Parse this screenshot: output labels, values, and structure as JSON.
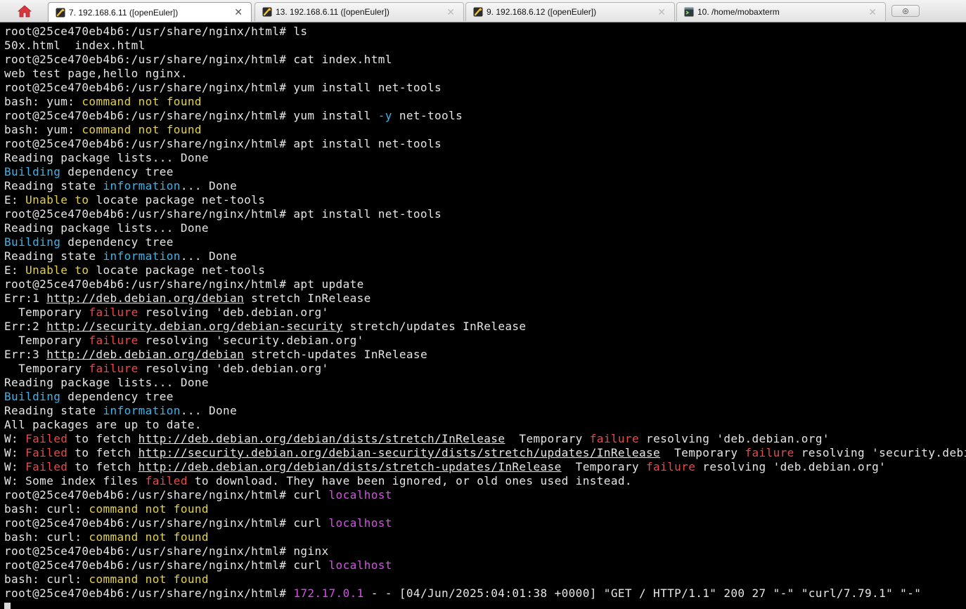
{
  "tabs": [
    {
      "label": "7. 192.168.6.11 ([openEuler])",
      "icon": "ssh-session-icon",
      "active": true
    },
    {
      "label": "13. 192.168.6.11 ([openEuler])",
      "icon": "ssh-session-icon",
      "active": false
    },
    {
      "label": "9. 192.168.6.12 ([openEuler])",
      "icon": "ssh-session-icon",
      "active": false
    },
    {
      "label": "10. /home/mobaxterm",
      "icon": "local-terminal-icon",
      "active": false
    }
  ],
  "tab_close_glyph": "✕",
  "colors": {
    "prompt": "#e6e6e6",
    "warning": "#e4d24a",
    "info": "#3fb3e6",
    "error": "#e84a4a",
    "highlight": "#d84fe8",
    "background": "#000000"
  },
  "lines": [
    {
      "segs": [
        {
          "t": "root@25ce470eb4b6:/usr/share/nginx/html# ls"
        }
      ]
    },
    {
      "segs": [
        {
          "t": "50x.html  index.html"
        }
      ]
    },
    {
      "segs": [
        {
          "t": "root@25ce470eb4b6:/usr/share/nginx/html# cat index.html"
        }
      ]
    },
    {
      "segs": [
        {
          "t": "web test page,hello nginx."
        }
      ]
    },
    {
      "segs": [
        {
          "t": "root@25ce470eb4b6:/usr/share/nginx/html# yum install net-tools"
        }
      ]
    },
    {
      "segs": [
        {
          "t": "bash: yum: "
        },
        {
          "t": "command not found",
          "c": "yellow"
        }
      ]
    },
    {
      "segs": [
        {
          "t": "root@25ce470eb4b6:/usr/share/nginx/html# yum install "
        },
        {
          "t": "-y",
          "c": "blue"
        },
        {
          "t": " net-tools"
        }
      ]
    },
    {
      "segs": [
        {
          "t": "bash: yum: "
        },
        {
          "t": "command not found",
          "c": "yellow"
        }
      ]
    },
    {
      "segs": [
        {
          "t": "root@25ce470eb4b6:/usr/share/nginx/html# apt install net-tools"
        }
      ]
    },
    {
      "segs": [
        {
          "t": "Reading package lists... Done"
        }
      ]
    },
    {
      "segs": [
        {
          "t": "Building",
          "c": "blue"
        },
        {
          "t": " dependency tree"
        }
      ]
    },
    {
      "segs": [
        {
          "t": "Reading state "
        },
        {
          "t": "information",
          "c": "blue"
        },
        {
          "t": "... Done"
        }
      ]
    },
    {
      "segs": [
        {
          "t": "E: "
        },
        {
          "t": "Unable to",
          "c": "yellow"
        },
        {
          "t": " locate package net-tools"
        }
      ]
    },
    {
      "segs": [
        {
          "t": "root@25ce470eb4b6:/usr/share/nginx/html# apt install net-tools"
        }
      ]
    },
    {
      "segs": [
        {
          "t": "Reading package lists... Done"
        }
      ]
    },
    {
      "segs": [
        {
          "t": "Building",
          "c": "blue"
        },
        {
          "t": " dependency tree"
        }
      ]
    },
    {
      "segs": [
        {
          "t": "Reading state "
        },
        {
          "t": "information",
          "c": "blue"
        },
        {
          "t": "... Done"
        }
      ]
    },
    {
      "segs": [
        {
          "t": "E: "
        },
        {
          "t": "Unable to",
          "c": "yellow"
        },
        {
          "t": " locate package net-tools"
        }
      ]
    },
    {
      "segs": [
        {
          "t": "root@25ce470eb4b6:/usr/share/nginx/html# apt update"
        }
      ]
    },
    {
      "segs": [
        {
          "t": "Err:1 "
        },
        {
          "t": "http://deb.debian.org/debian",
          "c": "url"
        },
        {
          "t": " stretch InRelease"
        }
      ]
    },
    {
      "segs": [
        {
          "t": "  Temporary "
        },
        {
          "t": "failure",
          "c": "red"
        },
        {
          "t": " resolving 'deb.debian.org'"
        }
      ]
    },
    {
      "segs": [
        {
          "t": "Err:2 "
        },
        {
          "t": "http://security.debian.org/debian-security",
          "c": "url"
        },
        {
          "t": " stretch/updates InRelease"
        }
      ]
    },
    {
      "segs": [
        {
          "t": "  Temporary "
        },
        {
          "t": "failure",
          "c": "red"
        },
        {
          "t": " resolving 'security.debian.org'"
        }
      ]
    },
    {
      "segs": [
        {
          "t": "Err:3 "
        },
        {
          "t": "http://deb.debian.org/debian",
          "c": "url"
        },
        {
          "t": " stretch-updates InRelease"
        }
      ]
    },
    {
      "segs": [
        {
          "t": "  Temporary "
        },
        {
          "t": "failure",
          "c": "red"
        },
        {
          "t": " resolving 'deb.debian.org'"
        }
      ]
    },
    {
      "segs": [
        {
          "t": "Reading package lists... Done"
        }
      ]
    },
    {
      "segs": [
        {
          "t": "Building",
          "c": "blue"
        },
        {
          "t": " dependency tree"
        }
      ]
    },
    {
      "segs": [
        {
          "t": "Reading state "
        },
        {
          "t": "information",
          "c": "blue"
        },
        {
          "t": "... Done"
        }
      ]
    },
    {
      "segs": [
        {
          "t": "All packages are up to date."
        }
      ]
    },
    {
      "segs": [
        {
          "t": "W: "
        },
        {
          "t": "Failed",
          "c": "red"
        },
        {
          "t": " to fetch "
        },
        {
          "t": "http://deb.debian.org/debian/dists/stretch/InRelease",
          "c": "url"
        },
        {
          "t": "  Temporary "
        },
        {
          "t": "failure",
          "c": "red"
        },
        {
          "t": " resolving 'deb.debian.org'"
        }
      ]
    },
    {
      "segs": [
        {
          "t": "W: "
        },
        {
          "t": "Failed",
          "c": "red"
        },
        {
          "t": " to fetch "
        },
        {
          "t": "http://security.debian.org/debian-security/dists/stretch/updates/InRelease",
          "c": "url"
        },
        {
          "t": "  Temporary "
        },
        {
          "t": "failure",
          "c": "red"
        },
        {
          "t": " resolving 'security.debi"
        }
      ]
    },
    {
      "segs": [
        {
          "t": "W: "
        },
        {
          "t": "Failed",
          "c": "red"
        },
        {
          "t": " to fetch "
        },
        {
          "t": "http://deb.debian.org/debian/dists/stretch-updates/InRelease",
          "c": "url"
        },
        {
          "t": "  Temporary "
        },
        {
          "t": "failure",
          "c": "red"
        },
        {
          "t": " resolving 'deb.debian.org'"
        }
      ]
    },
    {
      "segs": [
        {
          "t": "W: Some index files "
        },
        {
          "t": "failed",
          "c": "red"
        },
        {
          "t": " to download. They have been ignored, or old ones used instead."
        }
      ]
    },
    {
      "segs": [
        {
          "t": "root@25ce470eb4b6:/usr/share/nginx/html# curl "
        },
        {
          "t": "localhost",
          "c": "magenta"
        }
      ]
    },
    {
      "segs": [
        {
          "t": "bash: curl: "
        },
        {
          "t": "command not found",
          "c": "yellow"
        }
      ]
    },
    {
      "segs": [
        {
          "t": "root@25ce470eb4b6:/usr/share/nginx/html# curl "
        },
        {
          "t": "localhost",
          "c": "magenta"
        }
      ]
    },
    {
      "segs": [
        {
          "t": "bash: curl: "
        },
        {
          "t": "command not found",
          "c": "yellow"
        }
      ]
    },
    {
      "segs": [
        {
          "t": "root@25ce470eb4b6:/usr/share/nginx/html# nginx"
        }
      ]
    },
    {
      "segs": [
        {
          "t": "root@25ce470eb4b6:/usr/share/nginx/html# curl "
        },
        {
          "t": "localhost",
          "c": "magenta"
        }
      ]
    },
    {
      "segs": [
        {
          "t": "bash: curl: "
        },
        {
          "t": "command not found",
          "c": "yellow"
        }
      ]
    },
    {
      "segs": [
        {
          "t": "root@25ce470eb4b6:/usr/share/nginx/html# "
        },
        {
          "t": "172.17.0.1",
          "c": "magenta"
        },
        {
          "t": " - - [04/Jun/2025:04:01:38 +0000] \"GET / HTTP/1.1\" 200 27 \"-\" \"curl/7.79.1\" \"-\""
        }
      ]
    },
    {
      "segs": [],
      "cursor": true
    }
  ]
}
